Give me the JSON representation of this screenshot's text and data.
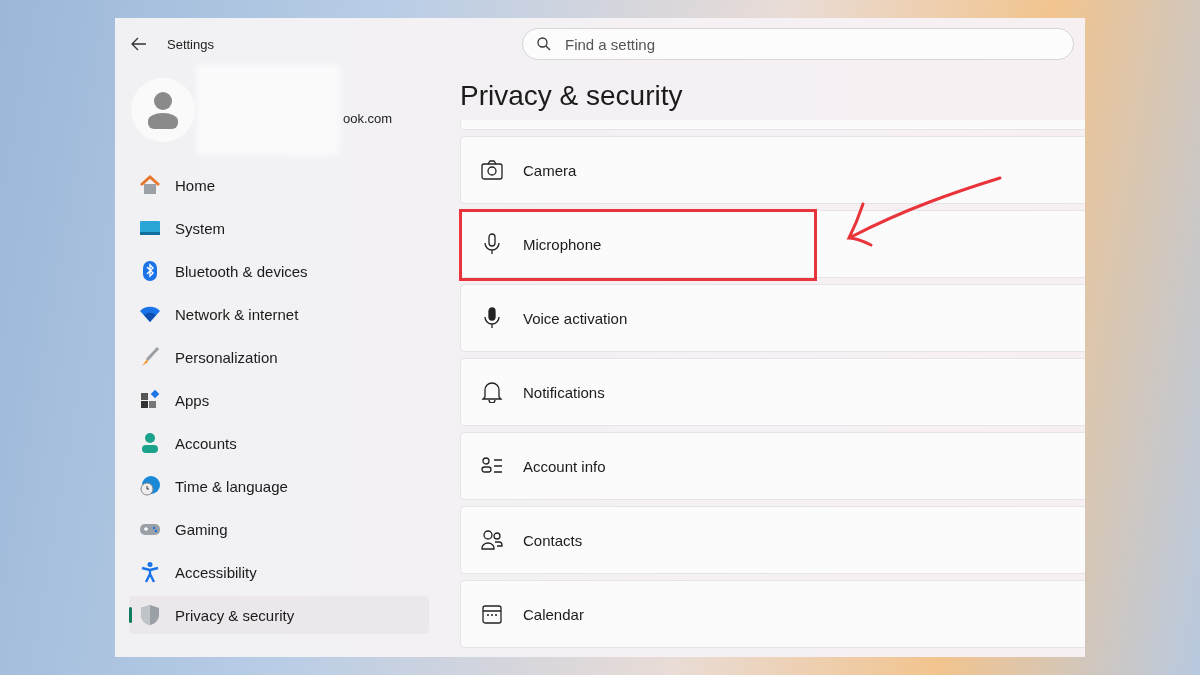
{
  "window": {
    "title": "Settings"
  },
  "search": {
    "placeholder": "Find a setting"
  },
  "account": {
    "email": "ook.com"
  },
  "sidebar": {
    "items": [
      {
        "label": "Home",
        "kind": "home",
        "selected": false
      },
      {
        "label": "System",
        "kind": "system",
        "selected": false
      },
      {
        "label": "Bluetooth & devices",
        "kind": "bluetooth",
        "selected": false
      },
      {
        "label": "Network & internet",
        "kind": "network",
        "selected": false
      },
      {
        "label": "Personalization",
        "kind": "brush",
        "selected": false
      },
      {
        "label": "Apps",
        "kind": "apps",
        "selected": false
      },
      {
        "label": "Accounts",
        "kind": "accounts",
        "selected": false
      },
      {
        "label": "Time & language",
        "kind": "time",
        "selected": false
      },
      {
        "label": "Gaming",
        "kind": "gaming",
        "selected": false
      },
      {
        "label": "Accessibility",
        "kind": "accessibility",
        "selected": false
      },
      {
        "label": "Privacy & security",
        "kind": "shield",
        "selected": true
      }
    ]
  },
  "page": {
    "title": "Privacy & security",
    "items": [
      {
        "label": "Camera",
        "kind": "camera",
        "highlighted": false
      },
      {
        "label": "Microphone",
        "kind": "microphone",
        "highlighted": true
      },
      {
        "label": "Voice activation",
        "kind": "voice",
        "highlighted": false
      },
      {
        "label": "Notifications",
        "kind": "bell",
        "highlighted": false
      },
      {
        "label": "Account info",
        "kind": "accountinfo",
        "highlighted": false
      },
      {
        "label": "Contacts",
        "kind": "contacts",
        "highlighted": false
      },
      {
        "label": "Calendar",
        "kind": "calendar",
        "highlighted": false
      }
    ]
  }
}
